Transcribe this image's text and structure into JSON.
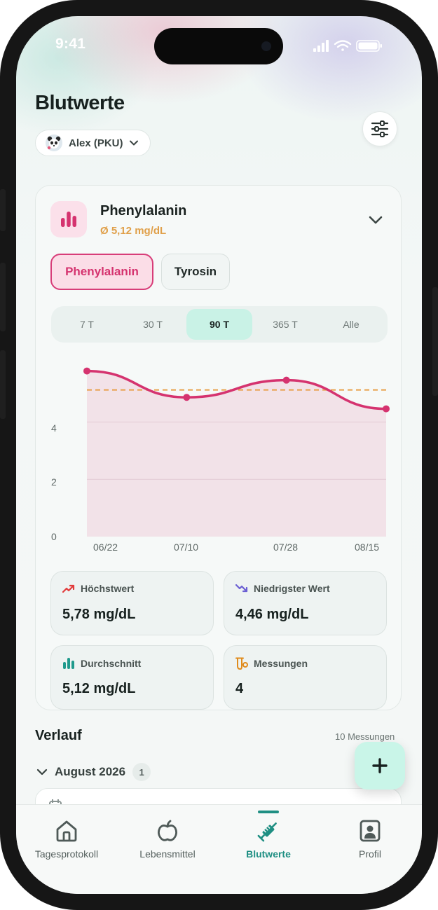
{
  "status_bar": {
    "time": "9:41"
  },
  "header": {
    "title": "Blutwerte",
    "user_selector": "Alex (PKU)"
  },
  "metric_card": {
    "name": "Phenylalanin",
    "average": "Ø 5,12 mg/dL",
    "segments": [
      "Phenylalanin",
      "Tyrosin"
    ],
    "selected_segment": "Phenylalanin",
    "ranges": [
      "7 T",
      "30 T",
      "90 T",
      "365 T",
      "Alle"
    ],
    "selected_range": "90 T",
    "accent_color": "#d5336f",
    "average_color": "#e0a04a"
  },
  "chart_data": {
    "type": "line",
    "x": [
      "06/15",
      "07/08",
      "07/31",
      "08/17"
    ],
    "y": [
      5.78,
      4.86,
      5.46,
      4.46
    ],
    "average_line": 5.12,
    "x_tick_labels": [
      "06/22",
      "07/10",
      "07/28",
      "08/15"
    ],
    "y_tick_labels": [
      "0",
      "2",
      "4"
    ],
    "ylim": [
      0,
      6
    ],
    "grid": true,
    "area_fill": true,
    "line_color": "#d5336f",
    "average_color": "#e8a04a"
  },
  "stats": {
    "max": {
      "label": "Höchstwert",
      "value": "5,78 mg/dL"
    },
    "min": {
      "label": "Niedrigster Wert",
      "value": "4,46 mg/dL"
    },
    "avg": {
      "label": "Durchschnitt",
      "value": "5,12 mg/dL"
    },
    "count": {
      "label": "Messungen",
      "value": "4"
    }
  },
  "history": {
    "title": "Verlauf",
    "count": "10 Messungen",
    "month": "August 2026",
    "month_count": "1"
  },
  "tabbar": {
    "items": [
      {
        "label": "Tagesprotokoll",
        "icon": "home-icon"
      },
      {
        "label": "Lebensmittel",
        "icon": "apple-icon"
      },
      {
        "label": "Blutwerte",
        "icon": "syringe-icon"
      },
      {
        "label": "Profil",
        "icon": "profile-icon"
      }
    ],
    "active": "Blutwerte"
  }
}
